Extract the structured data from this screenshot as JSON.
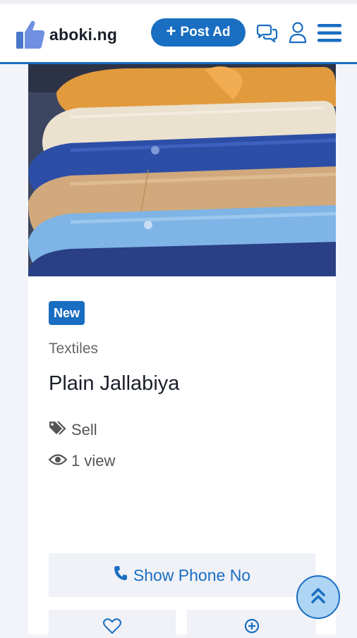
{
  "header": {
    "brand": "aboki.ng",
    "post_ad_label": "Post Ad",
    "icons": [
      "thumbs-up-logo-icon",
      "chat-icon",
      "user-icon",
      "menu-icon"
    ]
  },
  "listing": {
    "badge": "New",
    "category": "Textiles",
    "title": "Plain Jallabiya",
    "type": "Sell",
    "views": "1 view",
    "show_phone_label": "Show Phone No"
  },
  "colors": {
    "accent": "#1a6ec1",
    "scroll_button_bg": "#aed5f4"
  }
}
